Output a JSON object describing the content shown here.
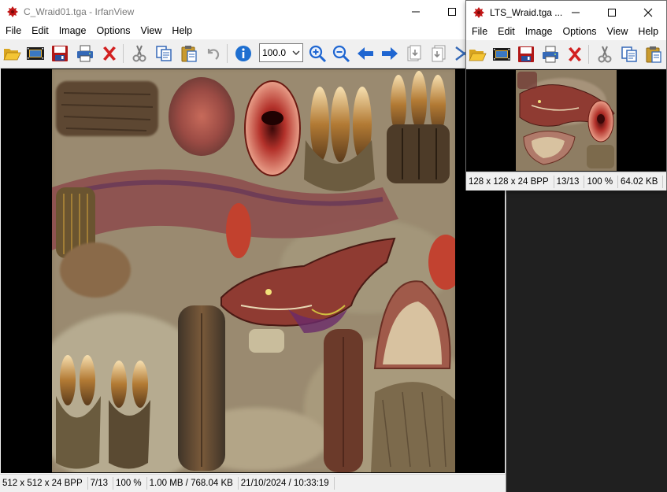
{
  "main_window": {
    "title": "C_Wraid01.tga - IrfanView",
    "menu": [
      "File",
      "Edit",
      "Image",
      "Options",
      "View",
      "Help"
    ],
    "zoom_value": "100.0",
    "status": [
      "512 x 512 x 24 BPP",
      "7/13",
      "100 %",
      "1.00 MB / 768.04 KB",
      "21/10/2024 / 10:33:19"
    ]
  },
  "second_window": {
    "title": "LTS_Wraid.tga ...",
    "menu": [
      "File",
      "Edit",
      "Image",
      "Options",
      "View",
      "Help"
    ],
    "status": [
      "128 x 128 x 24 BPP",
      "13/13",
      "100 %",
      "64.02 KB"
    ]
  },
  "toolbar_icons": [
    "open-folder-icon",
    "slideshow-icon",
    "save-icon",
    "print-icon",
    "delete-icon",
    "cut-icon",
    "copy-icon",
    "paste-icon",
    "undo-icon",
    "info-icon",
    "zoom-in-icon",
    "zoom-out-icon",
    "previous-icon",
    "next-icon",
    "page-first-icon",
    "page-last-icon",
    "scissors-icon"
  ],
  "colors": {
    "delete_red": "#d22020",
    "arrow_blue": "#1f66d1",
    "save_red": "#b01818",
    "viewer_bg": "#000000",
    "desktop_bg": "#202020"
  }
}
